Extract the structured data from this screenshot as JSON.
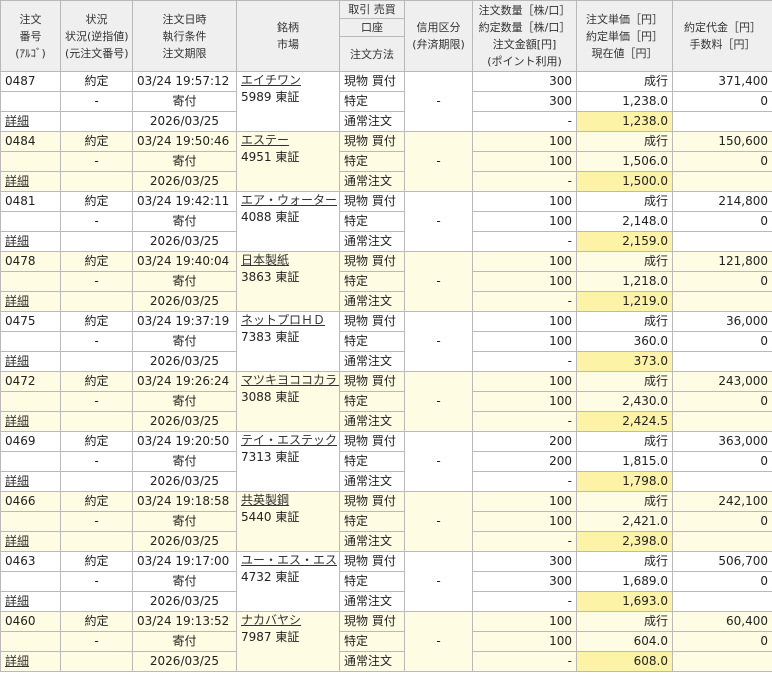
{
  "header": {
    "order_no": "注文\n番号\n(ｱﾙｺﾞ)",
    "status": "状況\n状況(逆指値)\n(元注文番号)",
    "datetime": "注文日時\n執行条件\n注文期限",
    "issue": "銘柄\n市場",
    "trade": "取引 売買",
    "account": "口座",
    "method": "注文方法",
    "margin": "信用区分\n(弁済期限)",
    "qty": "注文数量［株/口］\n約定数量［株/口］\n注文金額[円]\n(ポイント利用)",
    "price": "注文単価［円］\n約定単価［円］\n現在値［円］",
    "fee": "約定代金［円］\n手数料［円］"
  },
  "rows": [
    {
      "no": "0487",
      "status": "約定",
      "sub": "-",
      "time": "03/24 19:57:12",
      "cond": "寄付",
      "expiry": "2026/03/25",
      "name": "エイチワン",
      "code": "5989 東証",
      "trade": "現物 買付",
      "account": "特定",
      "method": "通常注文",
      "margin": "-",
      "qty": "300",
      "fill_qty": "300",
      "amount": "-",
      "price": "成行",
      "fill_price": "1,238.0",
      "cur": "1,238.0",
      "value": "371,400",
      "fee": "0",
      "detail": "詳細"
    },
    {
      "no": "0484",
      "status": "約定",
      "sub": "-",
      "time": "03/24 19:50:46",
      "cond": "寄付",
      "expiry": "2026/03/25",
      "name": "エステー",
      "code": "4951 東証",
      "trade": "現物 買付",
      "account": "特定",
      "method": "通常注文",
      "margin": "-",
      "qty": "100",
      "fill_qty": "100",
      "amount": "-",
      "price": "成行",
      "fill_price": "1,506.0",
      "cur": "1,500.0",
      "value": "150,600",
      "fee": "0",
      "detail": "詳細"
    },
    {
      "no": "0481",
      "status": "約定",
      "sub": "-",
      "time": "03/24 19:42:11",
      "cond": "寄付",
      "expiry": "2026/03/25",
      "name": "エア・ウォーター",
      "code": "4088 東証",
      "trade": "現物 買付",
      "account": "特定",
      "method": "通常注文",
      "margin": "-",
      "qty": "100",
      "fill_qty": "100",
      "amount": "-",
      "price": "成行",
      "fill_price": "2,148.0",
      "cur": "2,159.0",
      "value": "214,800",
      "fee": "0",
      "detail": "詳細"
    },
    {
      "no": "0478",
      "status": "約定",
      "sub": "-",
      "time": "03/24 19:40:04",
      "cond": "寄付",
      "expiry": "2026/03/25",
      "name": "日本製紙",
      "code": "3863 東証",
      "trade": "現物 買付",
      "account": "特定",
      "method": "通常注文",
      "margin": "-",
      "qty": "100",
      "fill_qty": "100",
      "amount": "-",
      "price": "成行",
      "fill_price": "1,218.0",
      "cur": "1,219.0",
      "value": "121,800",
      "fee": "0",
      "detail": "詳細"
    },
    {
      "no": "0475",
      "status": "約定",
      "sub": "-",
      "time": "03/24 19:37:19",
      "cond": "寄付",
      "expiry": "2026/03/25",
      "name": "ネットプロＨＤ",
      "code": "7383 東証",
      "trade": "現物 買付",
      "account": "特定",
      "method": "通常注文",
      "margin": "-",
      "qty": "100",
      "fill_qty": "100",
      "amount": "-",
      "price": "成行",
      "fill_price": "360.0",
      "cur": "373.0",
      "value": "36,000",
      "fee": "0",
      "detail": "詳細"
    },
    {
      "no": "0472",
      "status": "約定",
      "sub": "-",
      "time": "03/24 19:26:24",
      "cond": "寄付",
      "expiry": "2026/03/25",
      "name": "マツキヨココカラ＆カンパニー",
      "code": "3088 東証",
      "trade": "現物 買付",
      "account": "特定",
      "method": "通常注文",
      "margin": "-",
      "qty": "100",
      "fill_qty": "100",
      "amount": "-",
      "price": "成行",
      "fill_price": "2,430.0",
      "cur": "2,424.5",
      "value": "243,000",
      "fee": "0",
      "detail": "詳細"
    },
    {
      "no": "0469",
      "status": "約定",
      "sub": "-",
      "time": "03/24 19:20:50",
      "cond": "寄付",
      "expiry": "2026/03/25",
      "name": "テイ・エステック",
      "code": "7313 東証",
      "trade": "現物 買付",
      "account": "特定",
      "method": "通常注文",
      "margin": "-",
      "qty": "200",
      "fill_qty": "200",
      "amount": "-",
      "price": "成行",
      "fill_price": "1,815.0",
      "cur": "1,798.0",
      "value": "363,000",
      "fee": "0",
      "detail": "詳細"
    },
    {
      "no": "0466",
      "status": "約定",
      "sub": "-",
      "time": "03/24 19:18:58",
      "cond": "寄付",
      "expiry": "2026/03/25",
      "name": "共英製鋼",
      "code": "5440 東証",
      "trade": "現物 買付",
      "account": "特定",
      "method": "通常注文",
      "margin": "-",
      "qty": "100",
      "fill_qty": "100",
      "amount": "-",
      "price": "成行",
      "fill_price": "2,421.0",
      "cur": "2,398.0",
      "value": "242,100",
      "fee": "0",
      "detail": "詳細"
    },
    {
      "no": "0463",
      "status": "約定",
      "sub": "-",
      "time": "03/24 19:17:00",
      "cond": "寄付",
      "expiry": "2026/03/25",
      "name": "ユー・エス・エス",
      "code": "4732 東証",
      "trade": "現物 買付",
      "account": "特定",
      "method": "通常注文",
      "margin": "-",
      "qty": "300",
      "fill_qty": "300",
      "amount": "-",
      "price": "成行",
      "fill_price": "1,689.0",
      "cur": "1,693.0",
      "value": "506,700",
      "fee": "0",
      "detail": "詳細"
    },
    {
      "no": "0460",
      "status": "約定",
      "sub": "-",
      "time": "03/24 19:13:52",
      "cond": "寄付",
      "expiry": "2026/03/25",
      "name": "ナカバヤシ",
      "code": "7987 東証",
      "trade": "現物 買付",
      "account": "特定",
      "method": "通常注文",
      "margin": "-",
      "qty": "100",
      "fill_qty": "100",
      "amount": "-",
      "price": "成行",
      "fill_price": "604.0",
      "cur": "608.0",
      "value": "60,400",
      "fee": "0",
      "detail": "詳細"
    }
  ]
}
